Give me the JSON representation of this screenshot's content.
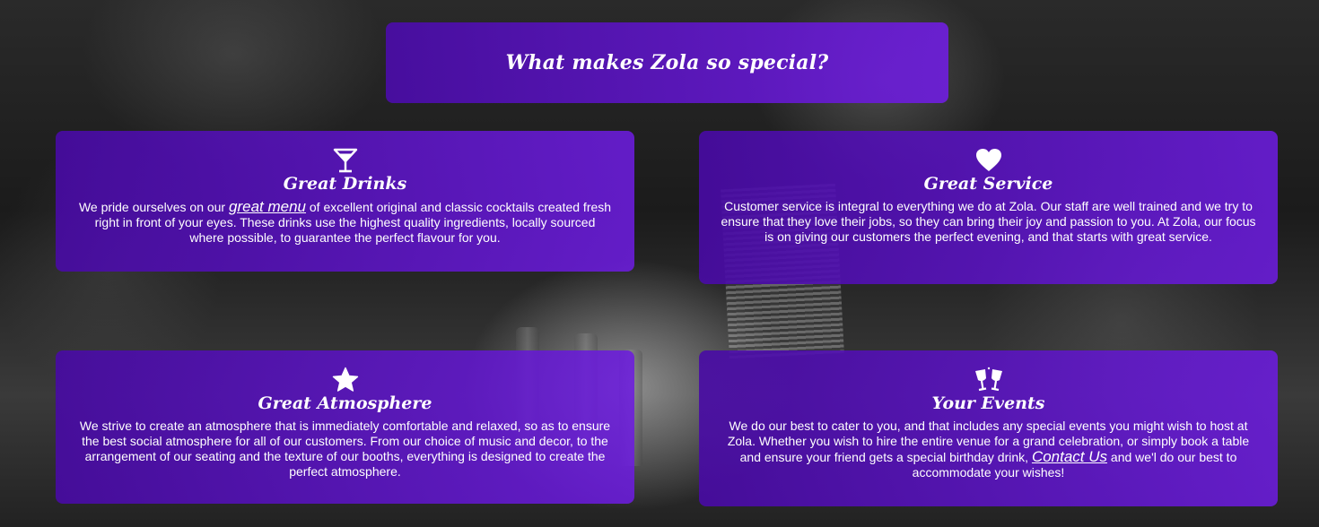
{
  "banner": {
    "title": "What makes Zola so special?"
  },
  "cards": {
    "drinks": {
      "icon": "cocktail-glass-icon",
      "title": "Great Drinks",
      "text_before": "We pride ourselves on our ",
      "link": "great menu",
      "text_after": " of excellent original and classic cocktails created fresh right in front of your eyes. These drinks use the highest quality ingredients, locally sourced where possible, to guarantee the perfect flavour for you."
    },
    "service": {
      "icon": "heart-icon",
      "title": "Great Service",
      "text": "Customer service is integral to everything we do at Zola. Our staff are well trained and we try to ensure that they love their jobs, so they can bring their joy and passion to you. At Zola, our focus is on giving our customers the perfect evening, and that starts with great service."
    },
    "atmosphere": {
      "icon": "star-icon",
      "title": "Great Atmosphere",
      "text": "We strive to create an atmosphere that is immediately comfortable and relaxed, so as to ensure the best social atmosphere for all of our customers. From our choice of music and decor, to the arrangement of our seating and the texture of our booths, everything is designed to create the perfect atmosphere."
    },
    "events": {
      "icon": "champagne-glasses-icon",
      "title": "Your Events",
      "text_before": "We do our best to cater to you, and that includes any special events you might wish to host at Zola. Whether you wish to hire the entire venue for a grand celebration, or simply book a table and ensure your friend gets a special birthday drink, ",
      "link": "Contact Us",
      "text_after": " and we'l do our best to accommodate your wishes!"
    }
  },
  "colors": {
    "card_start": "#4a0aa5",
    "card_end": "#6c1cde",
    "text": "#ffffff"
  }
}
